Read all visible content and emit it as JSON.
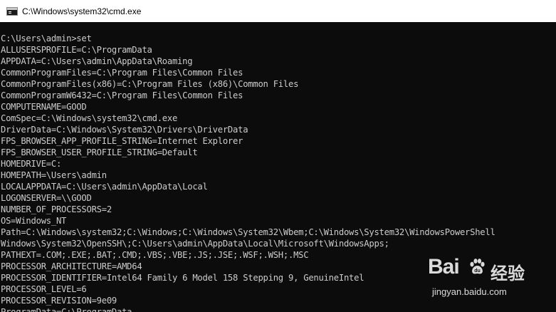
{
  "window": {
    "title": "C:\\Windows\\system32\\cmd.exe",
    "icon": "console-icon"
  },
  "console": {
    "lines": [
      "C:\\Users\\admin>set",
      "ALLUSERSPROFILE=C:\\ProgramData",
      "APPDATA=C:\\Users\\admin\\AppData\\Roaming",
      "CommonProgramFiles=C:\\Program Files\\Common Files",
      "CommonProgramFiles(x86)=C:\\Program Files (x86)\\Common Files",
      "CommonProgramW6432=C:\\Program Files\\Common Files",
      "COMPUTERNAME=GOOD",
      "ComSpec=C:\\Windows\\system32\\cmd.exe",
      "DriverData=C:\\Windows\\System32\\Drivers\\DriverData",
      "FPS_BROWSER_APP_PROFILE_STRING=Internet Explorer",
      "FPS_BROWSER_USER_PROFILE_STRING=Default",
      "HOMEDRIVE=C:",
      "HOMEPATH=\\Users\\admin",
      "LOCALAPPDATA=C:\\Users\\admin\\AppData\\Local",
      "LOGONSERVER=\\\\GOOD",
      "NUMBER_OF_PROCESSORS=2",
      "OS=Windows_NT",
      "Path=C:\\Windows\\system32;C:\\Windows;C:\\Windows\\System32\\Wbem;C:\\Windows\\System32\\WindowsPowerShell",
      "Windows\\System32\\OpenSSH\\;C:\\Users\\admin\\AppData\\Local\\Microsoft\\WindowsApps;",
      "PATHEXT=.COM;.EXE;.BAT;.CMD;.VBS;.VBE;.JS;.JSE;.WSF;.WSH;.MSC",
      "PROCESSOR_ARCHITECTURE=AMD64",
      "PROCESSOR_IDENTIFIER=Intel64 Family 6 Model 158 Stepping 9, GenuineIntel",
      "PROCESSOR_LEVEL=6",
      "PROCESSOR_REVISION=9e09",
      "ProgramData=C:\\ProgramData"
    ],
    "colors": {
      "background": "#0c0c0c",
      "text": "#cccccc"
    }
  },
  "watermark": {
    "logo": "Bai",
    "brand_cn": "经验",
    "url": "jingyan.baidu.com"
  }
}
